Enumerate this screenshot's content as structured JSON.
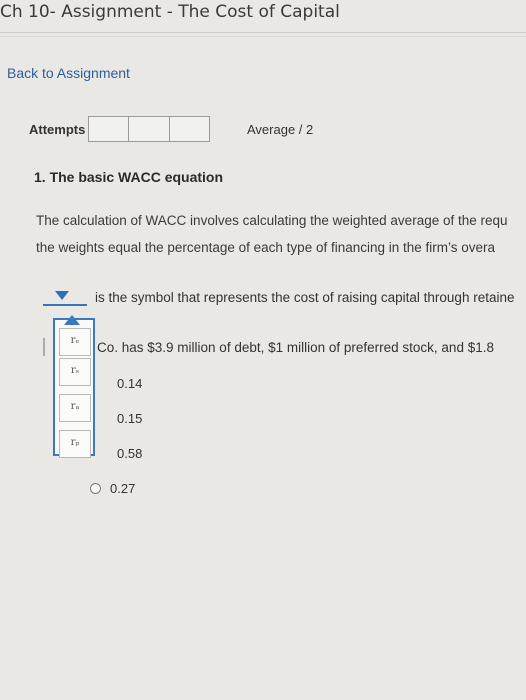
{
  "header": {
    "title": "Ch 10- Assignment - The Cost of Capital"
  },
  "nav": {
    "back_label": "Back to Assignment"
  },
  "attempts": {
    "label": "Attempts",
    "cells": 3,
    "average_label": "Average / 2"
  },
  "question": {
    "title": "1. The basic WACC equation",
    "para_line1": "The calculation of WACC involves calculating the weighted average of the requ",
    "para_line2": "the weights equal the percentage of each type of financing in the firm’s overa",
    "sentence": "is the symbol that represents the cost of raising capital through retaine",
    "dropdown_options": [
      "rₑ",
      "rₛ",
      "rₐ",
      "rₚ"
    ],
    "dropdown_option_text": [
      "re",
      "rs",
      "rd",
      "rp"
    ],
    "debt_line": "Co. has $3.9 million of debt, $1 million of preferred stock, and $1.8",
    "answers": [
      "0.14",
      "0.15",
      "0.58",
      "0.27"
    ]
  },
  "colors": {
    "accent": "#3a78c0",
    "link": "#2f5d99",
    "background": "#e9e8e5"
  }
}
